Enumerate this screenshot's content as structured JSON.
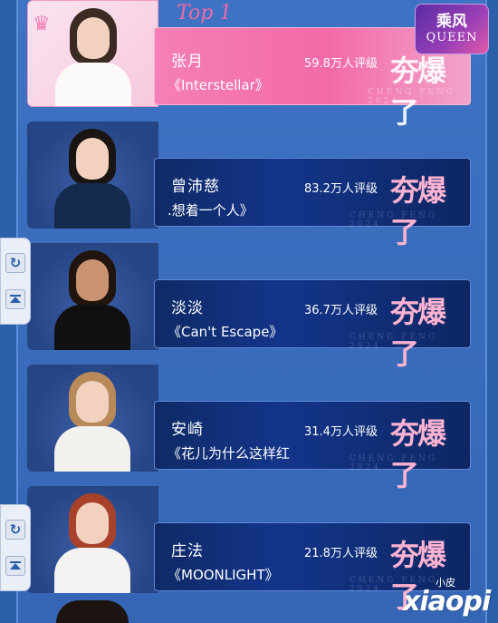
{
  "top_tag": "Top 1",
  "badge": {
    "cn": "乘风",
    "en": "QUEEN"
  },
  "logo": {
    "small": "小皮",
    "big": "xiaopi"
  },
  "contestants": [
    {
      "name": "张月",
      "song": "《Interstellar》",
      "votes": "59.8万人评级",
      "rating": "夯爆了",
      "watermark": "CHENG FENG 2024"
    },
    {
      "name": "曾沛慈",
      "song": ".想着一个人》",
      "votes": "83.2万人评级",
      "rating": "夯爆了",
      "watermark": "CHENG FENG 2024"
    },
    {
      "name": "淡淡",
      "song": "《Can't Escape》",
      "votes": "36.7万人评级",
      "rating": "夯爆了",
      "watermark": "CHENG FENG 2024"
    },
    {
      "name": "安崎",
      "song": "《花儿为什么这样红",
      "votes": "31.4万人评级",
      "rating": "夯爆了",
      "watermark": "CHENG FENG 2024"
    },
    {
      "name": "庄法",
      "song": "《MOONLIGHT》",
      "votes": "21.8万人评级",
      "rating": "夯爆了",
      "watermark": "CHENG FENG 2024"
    }
  ],
  "colors": {
    "accent_pink": "#f36aa9",
    "panel_blue": "#13358a",
    "bg_blue": "#2b5fa9"
  }
}
